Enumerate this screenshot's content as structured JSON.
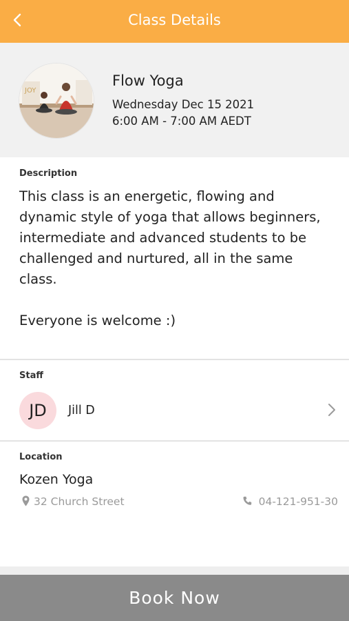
{
  "header": {
    "title": "Class Details"
  },
  "class": {
    "name": "Flow Yoga",
    "date": "Wednesday Dec 15 2021",
    "time": "6:00 AM - 7:00 AM AEDT",
    "image": "yoga-class-photo"
  },
  "description": {
    "label": "Description",
    "text": "This class is an energetic, flowing and dynamic style of yoga that allows beginners, intermediate and advanced students to be challenged and nurtured, all in the same class.\n\nEveryone is welcome :)"
  },
  "staff": {
    "label": "Staff",
    "initials": "JD",
    "name": "Jill D"
  },
  "location": {
    "label": "Location",
    "name": "Kozen Yoga",
    "address": "32 Church Street",
    "phone": "04-121-951-30"
  },
  "actions": {
    "book_label": "Book Now"
  },
  "colors": {
    "header_bg": "#FAAD45",
    "book_button_bg": "#8A8A8A",
    "avatar_bg": "#FADADD"
  },
  "icons": {
    "back": "chevron-left-icon",
    "staff_link": "chevron-right-icon",
    "address": "map-pin-icon",
    "phone": "phone-icon"
  }
}
